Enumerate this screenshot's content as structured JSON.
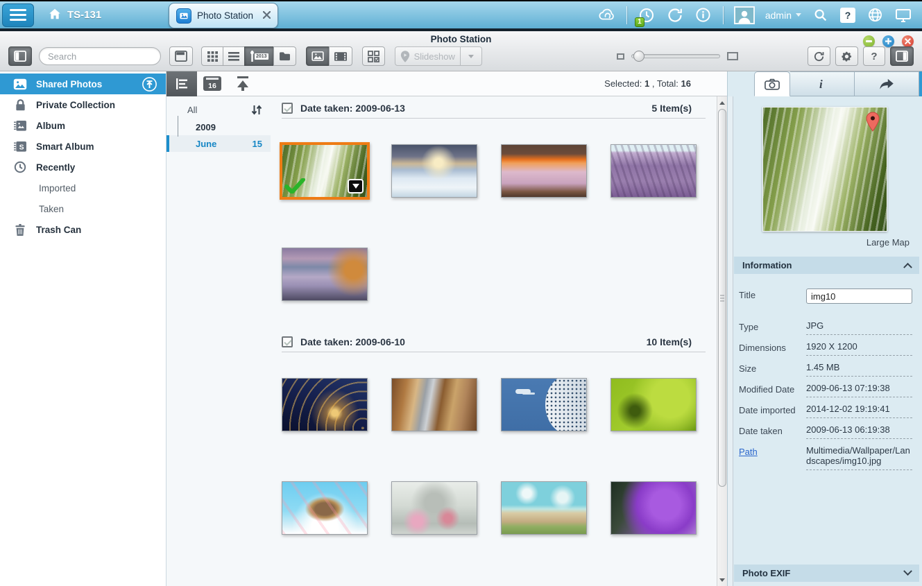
{
  "topbar": {
    "device_name": "TS-131",
    "tab_label": "Photo Station",
    "notification_count": "1",
    "username": "admin"
  },
  "toolbar": {
    "title": "Photo Station",
    "search_placeholder": "Search",
    "view_timeline_badge": "2013",
    "slideshow_label": "Slideshow",
    "help_glyph": "?"
  },
  "sidebar": {
    "items": [
      {
        "label": "Shared Photos",
        "icon": "photo-icon",
        "selected": true
      },
      {
        "label": "Private Collection",
        "icon": "lock-icon"
      },
      {
        "label": "Album",
        "icon": "album-icon"
      },
      {
        "label": "Smart Album",
        "icon": "smart-album-icon"
      },
      {
        "label": "Recently",
        "icon": "clock-icon"
      },
      {
        "label": "Imported",
        "indent": true
      },
      {
        "label": "Taken",
        "indent": true
      },
      {
        "label": "Trash Can",
        "icon": "trash-icon"
      }
    ]
  },
  "browser": {
    "calendar_badge": "16",
    "status": {
      "selected_label": "Selected:",
      "selected_value": "1",
      "total_label": ", Total:",
      "total_value": "16"
    },
    "timeline": {
      "all_label": "All",
      "year": "2009",
      "month": "June",
      "month_count": "15"
    },
    "sections": [
      {
        "title": "Date taken: 2009-06-13",
        "count": "5 Item(s)",
        "rows": [
          [
            "waterfall",
            "iceberg",
            "canyon",
            "lavender"
          ],
          [
            "ocean"
          ]
        ]
      },
      {
        "title": "Date taken: 2009-06-10",
        "count": "10 Item(s)",
        "rows": [
          [
            "tunnel",
            "metal",
            "dome",
            "succulent"
          ],
          [
            "island",
            "pastel",
            "town",
            "thistle"
          ]
        ]
      }
    ],
    "selected_photo": "waterfall"
  },
  "infopanel": {
    "large_map_label": "Large Map",
    "information_header": "Information",
    "photo_exif_header": "Photo EXIF",
    "title_label": "Title",
    "title_value": "img10",
    "fields": [
      {
        "label": "Type",
        "value": "JPG"
      },
      {
        "label": "Dimensions",
        "value": "1920 X 1200"
      },
      {
        "label": "Size",
        "value": "1.45 MB"
      },
      {
        "label": "Modified Date",
        "value": "2009-06-13 07:19:38"
      },
      {
        "label": "Date imported",
        "value": "2014-12-02 19:19:41"
      },
      {
        "label": "Date taken",
        "value": "2009-06-13 06:19:38"
      },
      {
        "label": "Path",
        "value": "Multimedia/Wallpaper/Landscapes/img10.jpg",
        "is_link": true
      }
    ]
  },
  "colors": {
    "topbar_blue": "#5fb0d4",
    "sidebar_selected_blue": "#2f99d3",
    "selection_orange": "#ee7c15",
    "check_green": "#2db52d",
    "panel_blue": "#dcebf2",
    "section_header_blue": "#c5dce8",
    "link_blue": "#2a66cc"
  }
}
